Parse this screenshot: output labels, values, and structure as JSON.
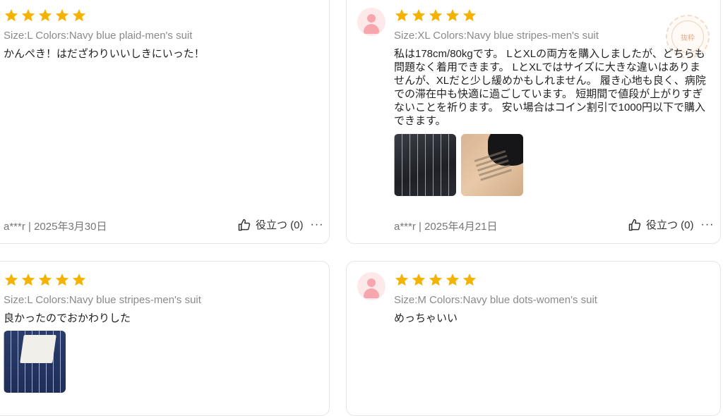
{
  "colors": {
    "star": "#f5b301",
    "avatar_bg": "#fde9ea",
    "avatar_fg": "#f7a6ad",
    "card_border": "#e6e6e6"
  },
  "reviews": [
    {
      "rating": 5,
      "meta": "Size:L Colors:Navy blue plaid-men's suit",
      "text": "かんぺき！はだざわりいいしきにいった！",
      "author_date": "a***r | 2025年3月30日",
      "helpful": "役立つ (0)",
      "more": "···"
    },
    {
      "rating": 5,
      "meta": "Size:XL Colors:Navy blue stripes-men's suit",
      "text": "私は178cm/80kgです。 LとXLの両方を購入しましたが、どちらも問題なく着用できます。 LとXLではサイズに大きな違いはありませんが、XLだと少し緩めかもしれません。 履き心地も良く、病院での滞在中も快適に過ごしています。 短期間で値段が上がりすぎないことを祈ります。 安い場合はコイン割引で1000円以下で購入できます。",
      "author_date": "a***r | 2025年4月21日",
      "helpful": "役立つ (0)",
      "more": "···",
      "badge": "抜粋",
      "images": [
        "striped-shirt-photo",
        "care-label-photo"
      ]
    },
    {
      "rating": 5,
      "meta": "Size:L Colors:Navy blue stripes-men's suit",
      "text": "良かったのでおかわりした",
      "images": [
        "navy-stripe-fabric-photo"
      ]
    },
    {
      "rating": 5,
      "meta": "Size:M Colors:Navy blue dots-women's suit",
      "text": "めっちゃいい"
    }
  ]
}
